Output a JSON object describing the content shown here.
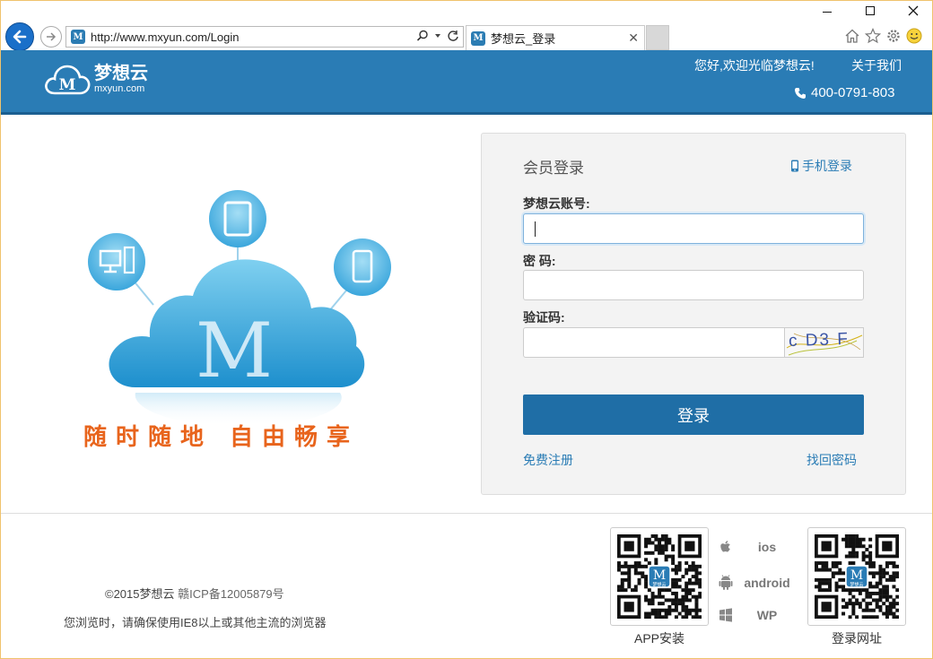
{
  "browser": {
    "url": "http://www.mxyun.com/Login",
    "tab_title": "梦想云_登录"
  },
  "header": {
    "logo_name": "梦想云",
    "logo_domain": "mxyun.com",
    "logo_mark": "M",
    "welcome": "您好,欢迎光临梦想云!",
    "about": "关于我们",
    "phone": "400-0791-803",
    "brand_color": "#2a7cb5"
  },
  "hero": {
    "cloud_letter": "M",
    "slogan": "随时随地  自由畅享"
  },
  "login": {
    "title": "会员登录",
    "mobile_login": "手机登录",
    "account_label": "梦想云账号:",
    "account_value": "",
    "password_label": "密 码:",
    "password_value": "",
    "captcha_label": "验证码:",
    "captcha_value": "",
    "captcha_image_text": "c D3 F",
    "submit_label": "登录",
    "register_link": "免费注册",
    "forgot_link": "找回密码",
    "button_color": "#1f6ea6"
  },
  "footer": {
    "copyright": "©2015梦想云",
    "icp": "赣ICP备12005879号",
    "browser_note": "您浏览时，请确保使用IE8以上或其他主流的浏览器",
    "qr_app_caption": "APP安装",
    "qr_login_caption": "登录网址",
    "qr_center_label": "梦想云",
    "platforms": [
      "ios",
      "android",
      "WP"
    ]
  }
}
